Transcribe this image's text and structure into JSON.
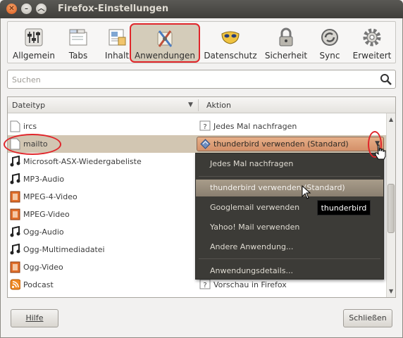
{
  "window": {
    "title": "Firefox-Einstellungen",
    "close_glyph": "✕",
    "minimize_glyph": "–",
    "maximize_glyph": "︿"
  },
  "tabs": [
    {
      "label": "Allgemein",
      "icon": "sliders-icon",
      "active": false
    },
    {
      "label": "Tabs",
      "icon": "tabs-icon",
      "active": false
    },
    {
      "label": "Inhalt",
      "icon": "content-icon",
      "active": false
    },
    {
      "label": "Anwendungen",
      "icon": "applications-icon",
      "active": true
    },
    {
      "label": "Datenschutz",
      "icon": "mask-icon",
      "active": false
    },
    {
      "label": "Sicherheit",
      "icon": "lock-icon",
      "active": false
    },
    {
      "label": "Sync",
      "icon": "sync-icon",
      "active": false
    },
    {
      "label": "Erweitert",
      "icon": "gear-icon",
      "active": false
    }
  ],
  "search": {
    "placeholder": "Suchen",
    "value": ""
  },
  "list": {
    "header_type": "Dateityp",
    "header_action": "Aktion",
    "sort_glyph": "▼",
    "rows": [
      {
        "type": "ircs",
        "icon": "file-icon",
        "action": "Jedes Mal nachfragen",
        "action_icon": "question-icon"
      },
      {
        "type": "mailto",
        "icon": "file-icon",
        "action": "thunderbird verwenden (Standard)",
        "action_icon": "thunderbird-icon",
        "selected": true
      },
      {
        "type": "Microsoft-ASX-Wiedergabeliste",
        "icon": "music-icon"
      },
      {
        "type": "MP3-Audio",
        "icon": "music-icon"
      },
      {
        "type": "MPEG-4-Video",
        "icon": "video-icon"
      },
      {
        "type": "MPEG-Video",
        "icon": "video-icon"
      },
      {
        "type": "Ogg-Audio",
        "icon": "music-icon"
      },
      {
        "type": "Ogg-Multimediadatei",
        "icon": "music-icon"
      },
      {
        "type": "Ogg-Video",
        "icon": "video-icon"
      },
      {
        "type": "Podcast",
        "icon": "rss-icon",
        "action": "Vorschau in Firefox",
        "action_icon": "question-icon"
      }
    ]
  },
  "combo": {
    "selected": "thunderbird verwenden (Standard)",
    "arrow_glyph": "▼"
  },
  "dropdown": {
    "items": [
      {
        "label": "Jedes Mal nachfragen"
      },
      {
        "label": "thunderbird verwenden (Standard)",
        "highlighted": true
      },
      {
        "label": "Googlemail verwenden"
      },
      {
        "label": "Yahoo! Mail verwenden"
      },
      {
        "label": "Andere Anwendung..."
      },
      {
        "label": "Anwendungsdetails..."
      }
    ]
  },
  "tooltip": "thunderbird",
  "scrollbar": {
    "up_glyph": "▲",
    "down_glyph": "▼",
    "position": 0.35
  },
  "buttons": {
    "help": "Hilfe",
    "close": "Schließen"
  },
  "colors": {
    "accent_highlight": "#e0262b",
    "selection": "#d2c6b2",
    "menu_bg": "#3c3b37"
  }
}
